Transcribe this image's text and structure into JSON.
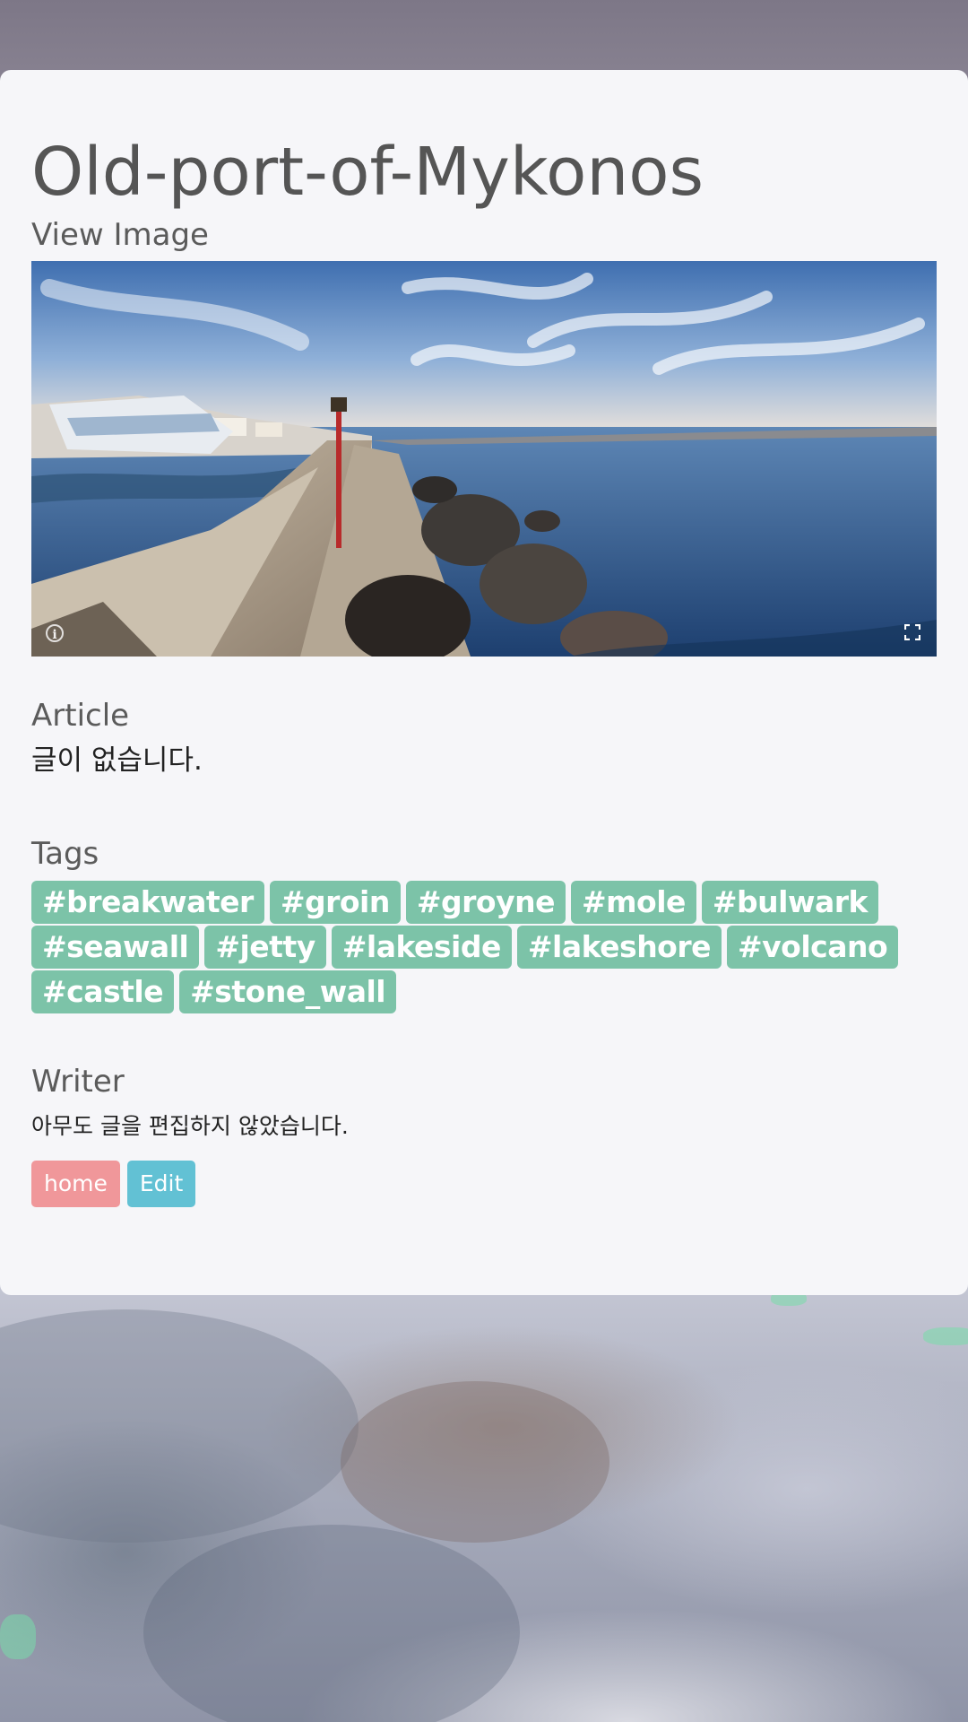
{
  "page": {
    "title": "Old-port-of-Mykonos",
    "view_image_label": "View Image"
  },
  "image": {
    "icons": [
      "info-icon",
      "fullscreen-icon"
    ]
  },
  "article": {
    "label": "Article",
    "text": "글이 없습니다."
  },
  "tags": {
    "label": "Tags",
    "items": [
      "#breakwater",
      "#groin",
      "#groyne",
      "#mole",
      "#bulwark",
      "#seawall",
      "#jetty",
      "#lakeside",
      "#lakeshore",
      "#volcano",
      "#castle",
      "#stone_wall"
    ]
  },
  "writer": {
    "label": "Writer",
    "text": "아무도 글을 편집하지 않았습니다."
  },
  "buttons": {
    "home_label": "home",
    "edit_label": "Edit"
  },
  "colors": {
    "tag_bg": "#7cc3a8",
    "home_button": "#f0979a",
    "edit_button": "#62c1d4",
    "card_bg": "#f6f6f9"
  }
}
